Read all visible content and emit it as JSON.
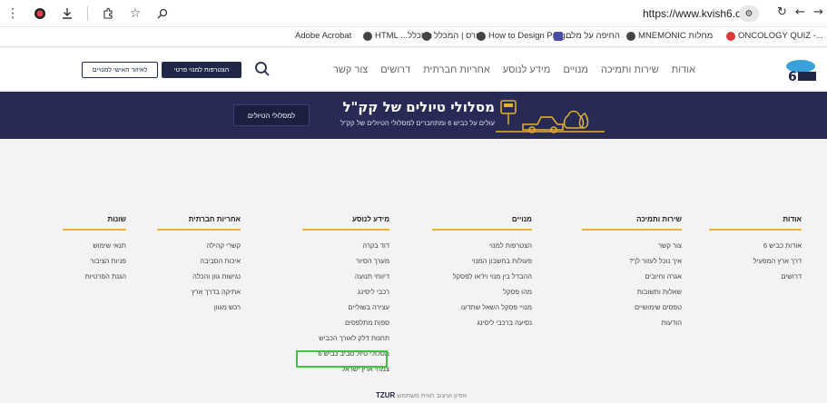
{
  "browser": {
    "url": "https://www.kvish6.co.il",
    "icons": [
      "more-vert-icon",
      "record-icon",
      "download-icon",
      "extensions-icon",
      "star-icon",
      "zoom-icon"
    ],
    "bookmarks": [
      {
        "label": "Adobe Acrobat",
        "color": "#2b2b2b"
      },
      {
        "label": "HTML ...החכלל",
        "color": "#2b2b2b"
      },
      {
        "label": "קורס | המכלל",
        "color": "#2b2b2b"
      },
      {
        "label": "How to Design Prog...",
        "color": "#2b2b2b"
      },
      {
        "label": "החיפה על מלם",
        "color": "#4a4aa8"
      },
      {
        "label": "MNEMONIC מחלות",
        "color": "#d93a3a"
      },
      {
        "label": "ONCOLOGY QUIZ -...",
        "color": "#2d6bd6"
      }
    ]
  },
  "header": {
    "nav": [
      "אודות",
      "שירות ותמיכה",
      "מנויים",
      "מידע לנוסע",
      "אחריות חברתית",
      "דרושים",
      "צור קשר"
    ],
    "primary_button": "הצטרפות למנוי פרטי",
    "secondary_button": "לאיזור האישי למנויים"
  },
  "banner": {
    "title": "מסלולי טיולים של קק\"ל",
    "subtitle": "עולים על כביש 6 ומתחברים למסלולי הטיולים של קק\"ל",
    "button": "למסלולי הטיולים"
  },
  "footer": {
    "columns": [
      {
        "title": "אודות",
        "items": [
          "אודות כביש 6",
          "דרך ארץ המפעיל",
          "דרושים"
        ]
      },
      {
        "title": "שירות ותמיכה",
        "items": [
          "צור קשר",
          "איך נוכל לעזור לך?",
          "אגרה וחיובים",
          "שאלות ותשובות",
          "טפסים שימושיים",
          "הודעות"
        ]
      },
      {
        "title": "מנויים",
        "items": [
          "הצטרפות למנוי",
          "פעולות בחשבון המנוי",
          "ההבדל בין מנוי וידאו לפסקל",
          "מהו פסקל",
          "מנויי פסקל השאל שתדעו",
          "נסיעה ברכבי ליסינג"
        ]
      },
      {
        "title": "מידע לנוסע",
        "items": [
          "דוד בקרה",
          "מערך הסיור",
          "דיווחי תנועה",
          "רכבי ליסינג",
          "עצירה בשוליים",
          "ספות מתלפסים",
          "תחנות דלק לאורך הכביש",
          "מסלולי טיול סביב כביש 6",
          "צמחי ארץ ישראל"
        ]
      },
      {
        "title": "אחריות חברתית",
        "items": [
          "קשרי קהילה",
          "איכות הסביבה",
          "נגישות גוון והכלה",
          "אתיקה בדרך ארץ",
          "רכש מגוון"
        ]
      },
      {
        "title": "שונות",
        "items": [
          "תנאי שימוש",
          "פניות הציבור",
          "הגנת הפרטיות"
        ]
      }
    ],
    "credit_brand": "TZUR",
    "credit_text": "אפיון ועיצוב חווית משתמש"
  }
}
